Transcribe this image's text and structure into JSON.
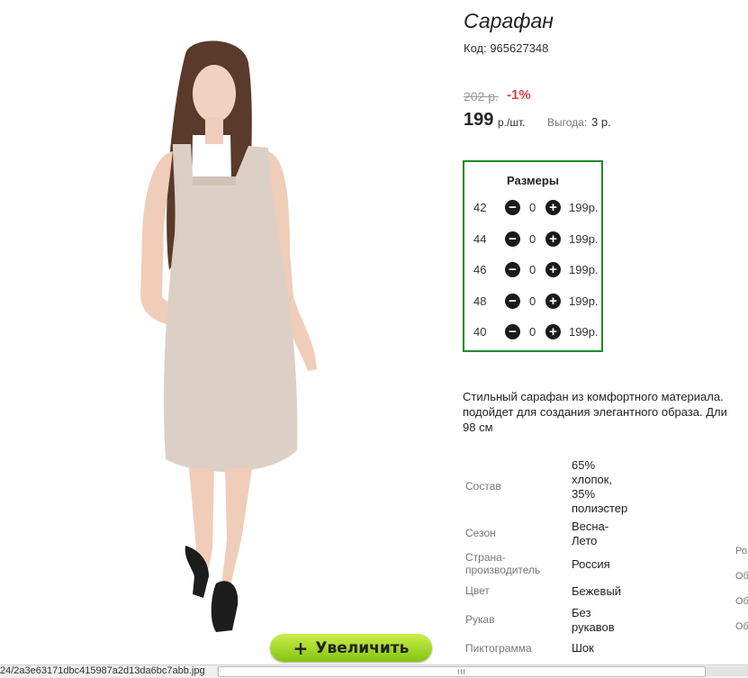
{
  "product": {
    "title": "Сарафан",
    "code": "Код: 965627348",
    "old_price": "202 р.",
    "discount": "-1%",
    "price": "199",
    "price_unit": "р./шт.",
    "profit_label": "Выгода:",
    "profit_value": "3 р."
  },
  "zoom_button": {
    "icon": "plus-icon",
    "label": "Увеличить"
  },
  "sizes": {
    "title": "Размеры",
    "rows": [
      {
        "size": "42",
        "qty": "0",
        "price": "199р."
      },
      {
        "size": "44",
        "qty": "0",
        "price": "199р."
      },
      {
        "size": "46",
        "qty": "0",
        "price": "199р."
      },
      {
        "size": "48",
        "qty": "0",
        "price": "199р."
      },
      {
        "size": "40",
        "qty": "0",
        "price": "199р."
      }
    ]
  },
  "description": {
    "line1": "Стильный сарафан из комфортного материала.",
    "line2": "подойдет для создания элегантного образа. Дли",
    "line3": "98 см"
  },
  "specs": [
    {
      "label": "Состав",
      "value_lines": [
        "65%",
        "хлопок,",
        "35%",
        "полиэстер"
      ]
    },
    {
      "label": "Сезон",
      "value_lines": [
        "Весна-",
        "Лето"
      ]
    },
    {
      "label_lines": [
        "Страна-",
        "производитель"
      ],
      "value_lines": [
        "Россия"
      ]
    },
    {
      "label": "Цвет",
      "value_lines": [
        "Бежевый"
      ]
    },
    {
      "label": "Рукав",
      "value_lines": [
        "Без",
        "рукавов"
      ]
    },
    {
      "label": "Пиктограмма",
      "value_lines": [
        "Шок"
      ]
    }
  ],
  "right_fragments": [
    "Ро",
    "Об",
    "Об",
    "Об"
  ],
  "status_bar": {
    "url_fragment": "24/2a3e63171dbc415987a2d13da6bc7abb.jpg",
    "scroll_grip": "III"
  },
  "colors": {
    "accent_green": "#1a8b2a",
    "discount_red": "#e0404a",
    "button_green": "#9bd628",
    "dress": "#dcd0c6"
  }
}
